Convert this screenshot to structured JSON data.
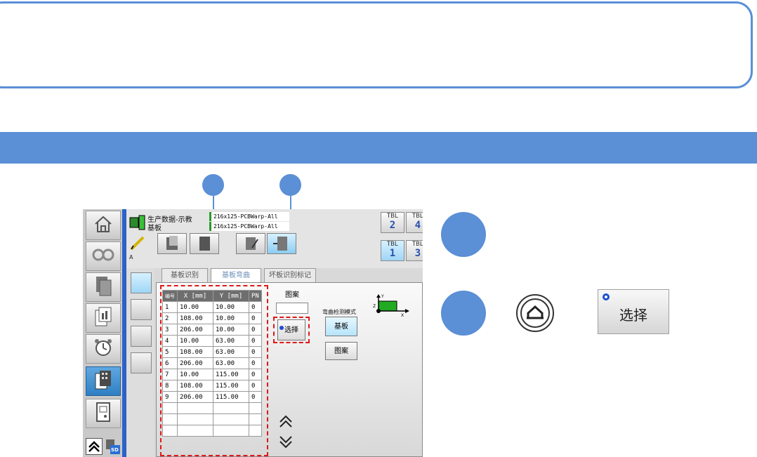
{
  "screen": {
    "header": {
      "line1": "生产数据-示教",
      "line2": "基板",
      "file1": "216x125-PCBWarp-All",
      "file2": "216x125-PCBWarp-All",
      "mode_letter": "A"
    },
    "tools": [
      {
        "label": "TBL",
        "num": "2"
      },
      {
        "label": "TBL",
        "num": "4"
      },
      {
        "label": "TBL",
        "num": "1"
      },
      {
        "label": "TBL",
        "num": "3"
      }
    ],
    "tabs": [
      "基板识别",
      "基板弯曲",
      "坏板识别标记"
    ],
    "table": {
      "headers": [
        "编号",
        "X [mm]",
        "Y [mm]",
        "PN"
      ],
      "rows": [
        [
          "1",
          "10.00",
          "10.00",
          "0"
        ],
        [
          "2",
          "108.00",
          "10.00",
          "0"
        ],
        [
          "3",
          "206.00",
          "10.00",
          "0"
        ],
        [
          "4",
          "10.00",
          "63.00",
          "0"
        ],
        [
          "5",
          "108.00",
          "63.00",
          "0"
        ],
        [
          "6",
          "206.00",
          "63.00",
          "0"
        ],
        [
          "7",
          "10.00",
          "115.00",
          "0"
        ],
        [
          "8",
          "108.00",
          "115.00",
          "0"
        ],
        [
          "9",
          "206.00",
          "115.00",
          "0"
        ],
        [
          "",
          "",
          "",
          ""
        ],
        [
          "",
          "",
          "",
          ""
        ],
        [
          "",
          "",
          "",
          ""
        ]
      ]
    },
    "pattern_label": "图案",
    "select_label": "选择",
    "detect_mode_label": "弯曲检测模式",
    "mode_board": "基板",
    "mode_pattern": "图案",
    "axis_y": "Y",
    "axis_x": "X",
    "axis_z": "Z",
    "sd_label": "SD"
  },
  "big_select_label": "选择",
  "accent_color": "#5b8fd6",
  "highlight_color": "#e01818"
}
